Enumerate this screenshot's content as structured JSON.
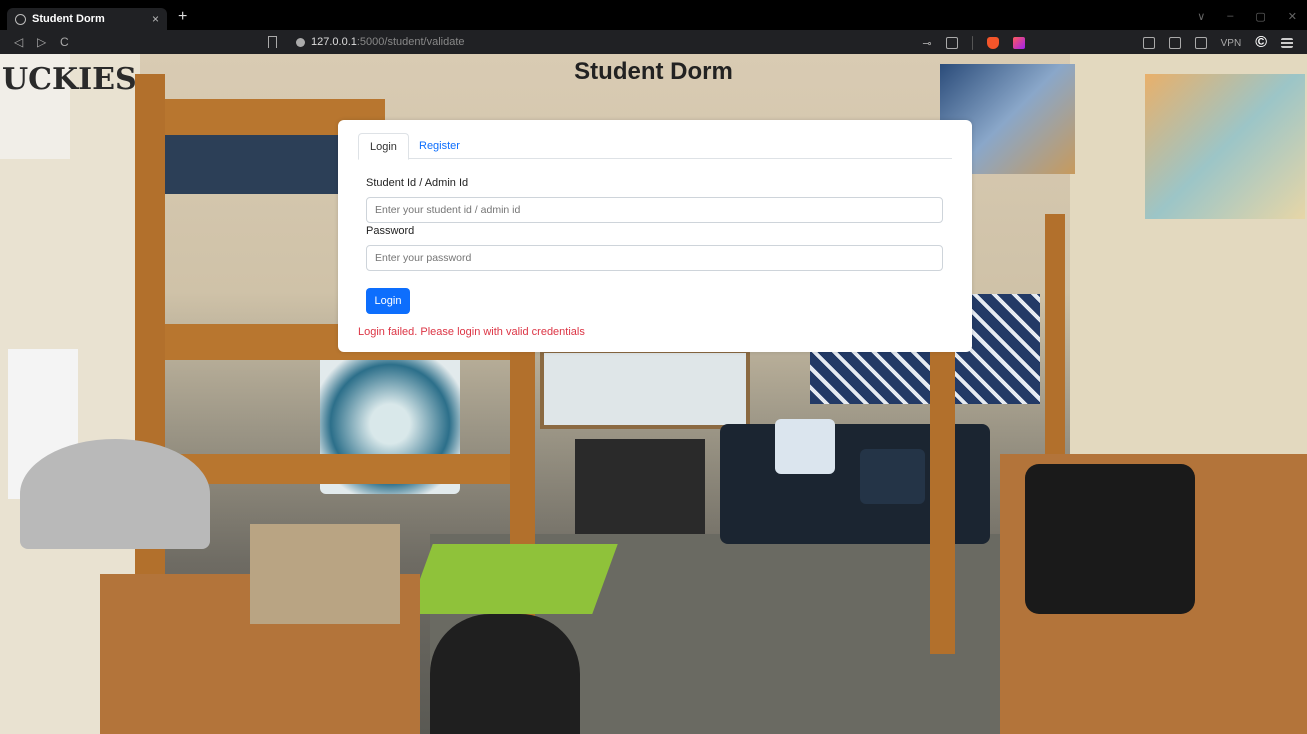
{
  "browser": {
    "tab_title": "Student Dorm",
    "tab_close": "×",
    "new_tab": "+",
    "url_host": "127.0.0.1",
    "url_path": ":5000/student/validate",
    "vpn_label": "VPN",
    "nav": {
      "back": "◁",
      "forward": "▷",
      "reload": "C"
    },
    "window_controls": [
      "∨",
      "–",
      "▢",
      "✕"
    ]
  },
  "page": {
    "title": "Student Dorm",
    "background_text": "UCKIES"
  },
  "login_form": {
    "tabs": [
      {
        "label": "Login",
        "active": true
      },
      {
        "label": "Register",
        "active": false
      }
    ],
    "id_label": "Student Id / Admin Id",
    "id_placeholder": "Enter your student id / admin id",
    "id_value": "",
    "password_label": "Password",
    "password_placeholder": "Enter your password",
    "password_value": "",
    "submit_label": "Login",
    "error_message": "Login failed. Please login with valid credentials"
  },
  "colors": {
    "primary": "#0d6efd",
    "error": "#dc3545",
    "chrome_bg": "#202124"
  }
}
